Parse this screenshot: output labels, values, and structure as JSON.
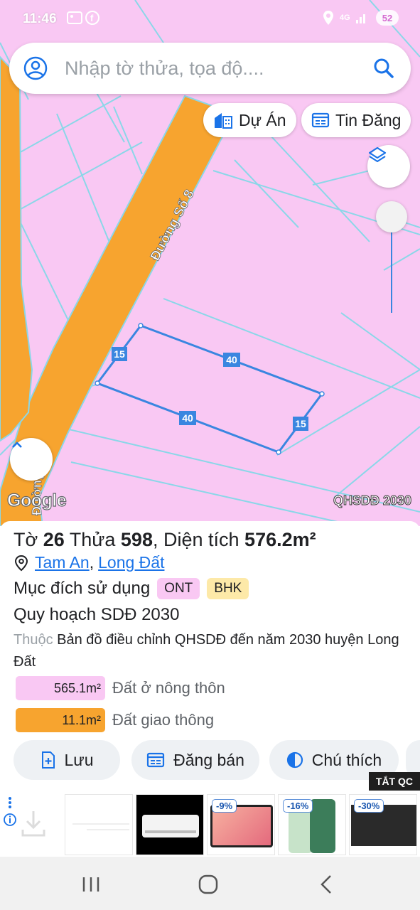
{
  "status_bar": {
    "time": "11:46",
    "network": "4G",
    "battery": "52",
    "icons": [
      "gallery-icon",
      "facebook-icon",
      "location-icon",
      "signal-icon"
    ]
  },
  "search": {
    "placeholder": "Nhập tờ thửa, tọa độ....",
    "icons": [
      "user-icon",
      "search-icon"
    ]
  },
  "chips": {
    "du_an": "Dự Án",
    "tin_dang": "Tin Đăng"
  },
  "map": {
    "road_name": "Đường Số 8",
    "road_name_2": "Đường",
    "edges": [
      "15",
      "40",
      "40",
      "15"
    ],
    "logo": "Google",
    "layer_label": "QHSDĐ 2030",
    "colors": {
      "land": "#f9c8f3",
      "road": "#f7a42f",
      "parcel": "#3a86e0",
      "lines": "#8ad7e8"
    }
  },
  "parcel": {
    "to_label": "Tờ",
    "to_value": "26",
    "thua_label": "Thửa",
    "thua_value": "598",
    "dientich_label": ", Diện tích",
    "dientich_value": "576.2m²",
    "location_1": "Tam An",
    "location_2": "Long Đất",
    "purpose_label": "Mục đích sử dụng",
    "purpose_badges": [
      "ONT",
      "BHK"
    ],
    "plan_title": "Quy hoạch SDĐ 2030",
    "source_prefix": "Thuộc",
    "source_text": "Bản đồ điều chỉnh QHSDĐ đến năm 2030 huyện Long Đất",
    "areas": [
      {
        "value": "565.1m²",
        "label": "Đất ở nông thôn",
        "color": "#f9c8f3"
      },
      {
        "value": "11.1m²",
        "label": "Đất giao thông",
        "color": "#f7a42f"
      }
    ]
  },
  "actions": {
    "save": "Lưu",
    "sell": "Đăng bán",
    "legend": "Chú thích"
  },
  "ads": {
    "close_label": "TẮT QC",
    "discounts": [
      "-9%",
      "-16%",
      "-30%"
    ]
  }
}
